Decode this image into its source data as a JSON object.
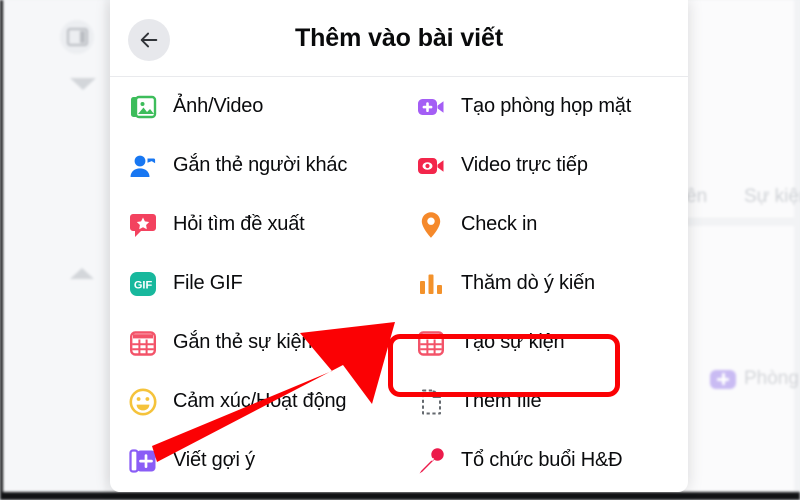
{
  "background": {
    "sidebar_toggle_icon": "sidebar-toggle-icon",
    "chevron_down_icon": "chevron-down-icon",
    "chevron_up_icon": "chevron-up-icon",
    "texts": {
      "partial_tab": "ên",
      "events_tab": "Sự kiện"
    },
    "room_shortcut": {
      "label": "Phòng",
      "icon": "video-plus-icon"
    }
  },
  "modal": {
    "title": "Thêm vào bài viết",
    "back_button": {
      "icon": "arrow-left-icon",
      "label": ""
    },
    "columns": {
      "left": [
        {
          "label": "Ảnh/Video",
          "icon": "photo-video-icon",
          "color": "#3dbd5b"
        },
        {
          "label": "Gắn thẻ người khác",
          "icon": "tag-person-icon",
          "color": "#1877f2"
        },
        {
          "label": "Hỏi tìm đề xuất",
          "icon": "ask-recommendation-icon",
          "color": "#f3425f"
        },
        {
          "label": "File GIF",
          "icon": "gif-icon",
          "color": "#18b89d"
        },
        {
          "label": "Gắn thẻ sự kiện",
          "icon": "tag-event-icon",
          "color": "#f35369"
        },
        {
          "label": "Cảm xúc/Hoạt động",
          "icon": "emoji-activity-icon",
          "color": "#f5c33b"
        },
        {
          "label": "Viết gợi ý",
          "icon": "write-prompt-icon",
          "color": "#8a5df6"
        }
      ],
      "right": [
        {
          "label": "Tạo phòng họp mặt",
          "icon": "video-plus-icon",
          "color": "#a45ef5"
        },
        {
          "label": "Video trực tiếp",
          "icon": "live-video-icon",
          "color": "#f3264b"
        },
        {
          "label": "Check in",
          "icon": "location-pin-icon",
          "color": "#f5892b"
        },
        {
          "label": "Thăm dò ý kiến",
          "icon": "poll-icon",
          "color": "#f3922b",
          "highlighted": true
        },
        {
          "label": "Tạo sự kiện",
          "icon": "create-event-icon",
          "color": "#f35369"
        },
        {
          "label": "Thêm file",
          "icon": "add-file-icon",
          "color": "#64696f"
        },
        {
          "label": "Tổ chức buổi H&Đ",
          "icon": "microphone-icon",
          "color": "#ec1b4b"
        }
      ]
    }
  },
  "annotations": {
    "highlight_color": "#fb0104",
    "highlight_target": "Thăm dò ý kiến",
    "arrow_color": "#fb0104",
    "arrow_icon": "pointer-arrow-icon"
  }
}
